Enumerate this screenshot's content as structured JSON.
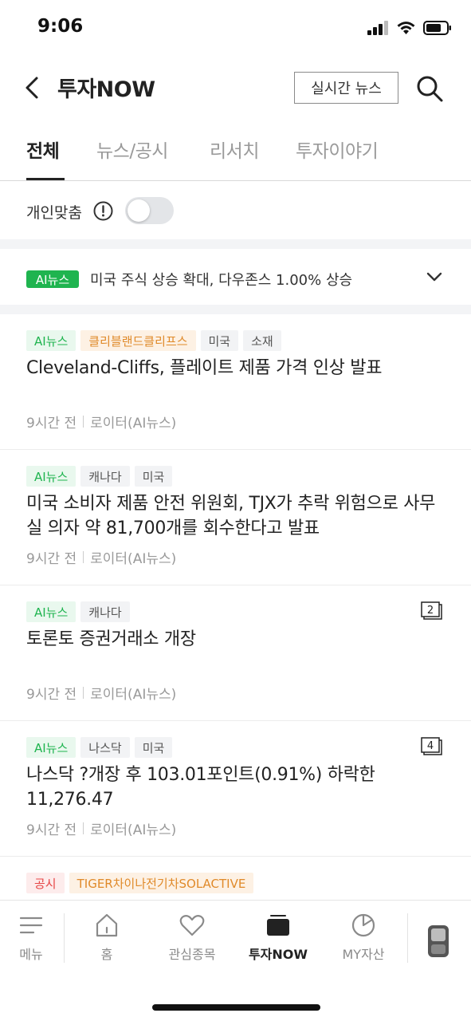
{
  "status_bar": {
    "time": "9:06"
  },
  "header": {
    "title": "투자NOW",
    "realtime_button": "실시간 뉴스"
  },
  "tabs": [
    {
      "label": "전체",
      "active": true
    },
    {
      "label": "뉴스/공시",
      "active": false
    },
    {
      "label": "리서치",
      "active": false
    },
    {
      "label": "투자이야기",
      "active": false
    }
  ],
  "personal": {
    "label": "개인맞춤",
    "toggle_on": false
  },
  "ai_banner": {
    "badge": "AI뉴스",
    "text": "미국 주식 상승 확대, 다우존스 1.00% 상승"
  },
  "news": [
    {
      "tags": [
        {
          "text": "AI뉴스",
          "style": "ai"
        },
        {
          "text": "클리블랜드클리프스",
          "style": "orange"
        },
        {
          "text": "미국",
          "style": "gray"
        },
        {
          "text": "소재",
          "style": "gray"
        }
      ],
      "title": "Cleveland-Cliffs, 플레이트 제품 가격 인상 발표",
      "time": "9시간 전",
      "source": "로이터(AI뉴스)",
      "count": ""
    },
    {
      "tags": [
        {
          "text": "AI뉴스",
          "style": "ai"
        },
        {
          "text": "캐나다",
          "style": "gray"
        },
        {
          "text": "미국",
          "style": "gray"
        }
      ],
      "title": "미국 소비자 제품 안전 위원회, TJX가 추락 위험으로 사무실 의자 약 81,700개를 회수한다고 발표",
      "time": "9시간 전",
      "source": "로이터(AI뉴스)",
      "count": ""
    },
    {
      "tags": [
        {
          "text": "AI뉴스",
          "style": "ai"
        },
        {
          "text": "캐나다",
          "style": "gray"
        }
      ],
      "title": "토론토 증권거래소 개장",
      "time": "9시간 전",
      "source": "로이터(AI뉴스)",
      "count": "2"
    },
    {
      "tags": [
        {
          "text": "AI뉴스",
          "style": "ai"
        },
        {
          "text": "나스닥",
          "style": "gray"
        },
        {
          "text": "미국",
          "style": "gray"
        }
      ],
      "title": "나스닥 ?개장 후 103.01포인트(0.91%) 하락한 11,276.47",
      "time": "9시간 전",
      "source": "로이터(AI뉴스)",
      "count": "4"
    },
    {
      "tags": [
        {
          "text": "공시",
          "style": "red"
        },
        {
          "text": "TIGER차이나전기차SOLACTIVE",
          "style": "orange"
        }
      ],
      "title": "",
      "time": "",
      "source": "",
      "count": ""
    }
  ],
  "bottom_nav": [
    {
      "label": "메뉴",
      "icon": "menu-icon",
      "active": false
    },
    {
      "label": "홈",
      "icon": "home-icon",
      "active": false
    },
    {
      "label": "관심종목",
      "icon": "heart-icon",
      "active": false
    },
    {
      "label": "투자NOW",
      "icon": "news-icon",
      "active": true
    },
    {
      "label": "MY자산",
      "icon": "pie-chart-icon",
      "active": false
    }
  ],
  "colors": {
    "ai_green": "#1fb44f",
    "orange": "#e08a2a",
    "red": "#e64545",
    "text": "#222222"
  }
}
